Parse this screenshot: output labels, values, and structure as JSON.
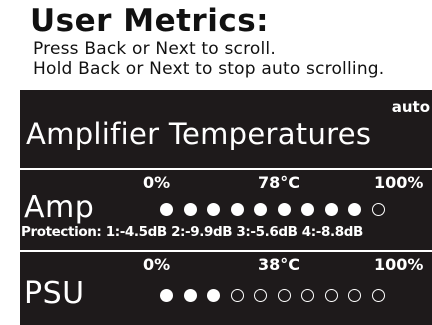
{
  "header": {
    "title": "User Metrics:",
    "line1": "Press Back or Next to scroll.",
    "line2": "Hold Back or Next to stop auto scrolling."
  },
  "panel": {
    "auto_label": "auto",
    "section_title": "Amplifier Temperatures"
  },
  "amp": {
    "label": "Amp",
    "scale_min": "0%",
    "scale_mid": "78°C",
    "scale_max": "100%",
    "level_total": 10,
    "level_filled": 9,
    "protection": "Protection: 1:-4.5dB 2:-9.9dB 3:-5.6dB 4:-8.8dB"
  },
  "psu": {
    "label": "PSU",
    "scale_min": "0%",
    "scale_mid": "38°C",
    "scale_max": "100%",
    "level_total": 10,
    "level_filled": 3
  },
  "colors": {
    "panel_background": "#1e1a1b",
    "panel_text": "#ffffff",
    "header_text": "#111111"
  }
}
